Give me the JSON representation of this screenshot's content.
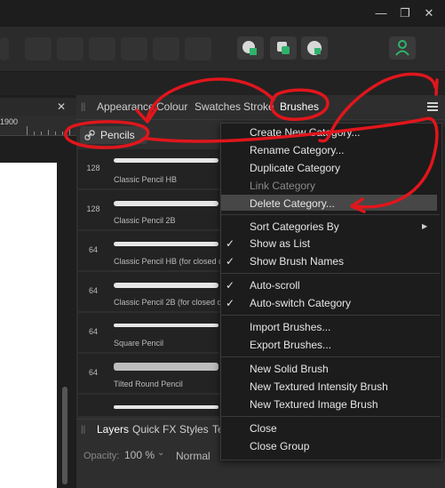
{
  "window": {
    "minimize": "—",
    "restore": "❐",
    "close": "✕"
  },
  "ruler": {
    "mark": "1900"
  },
  "panel_close": "✕",
  "tabs": [
    "Appearance",
    "Colour",
    "Swatches",
    "Stroke",
    "Brushes"
  ],
  "category": {
    "label": "Pencils"
  },
  "brushes": [
    {
      "size": "128",
      "name": "Classic Pencil HB"
    },
    {
      "size": "128",
      "name": "Classic Pencil 2B"
    },
    {
      "size": "64",
      "name": "Classic Pencil HB (for closed cu"
    },
    {
      "size": "64",
      "name": "Classic Pencil 2B (for closed c"
    },
    {
      "size": "64",
      "name": "Square Pencil"
    },
    {
      "size": "64",
      "name": "Tilted Round Pencil"
    }
  ],
  "bottom_tabs": [
    "Layers",
    "Quick FX",
    "Styles",
    "Te"
  ],
  "bottom_controls": {
    "opacity_label": "Opacity:",
    "opacity_value": "100 %",
    "blend_value": "Normal"
  },
  "menu": {
    "create_new_category": "Create New Category...",
    "rename_category": "Rename Category...",
    "duplicate_category": "Duplicate Category",
    "link_category": "Link Category",
    "delete_category": "Delete Category...",
    "sort_categories_by": "Sort Categories By",
    "show_as_list": "Show as List",
    "show_brush_names": "Show Brush Names",
    "auto_scroll": "Auto-scroll",
    "auto_switch_category": "Auto-switch Category",
    "import_brushes": "Import Brushes...",
    "export_brushes": "Export Brushes...",
    "new_solid_brush": "New Solid Brush",
    "new_textured_intensity_brush": "New Textured Intensity Brush",
    "new_textured_image_brush": "New Textured Image Brush",
    "close": "Close",
    "close_group": "Close Group",
    "check_glyph": "✓",
    "submenu_arrow": "▶"
  },
  "icons": {
    "panel_menu": "hamburger-menu-icon",
    "category_link": "link-icon",
    "user": "user-icon"
  },
  "colors": {
    "annotation": "#e0161c",
    "accent_green": "#2fb36b"
  }
}
